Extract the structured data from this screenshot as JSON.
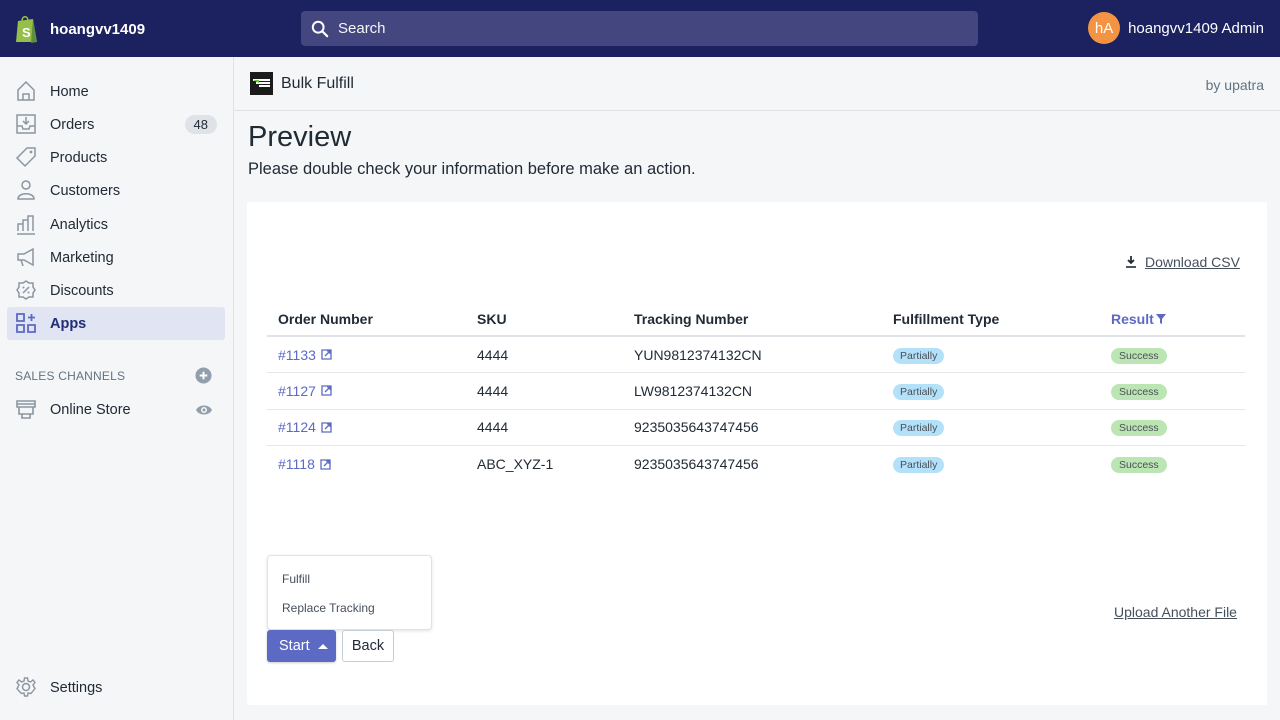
{
  "topbar": {
    "store_name": "hoangvv1409",
    "search_placeholder": "Search",
    "user_initials": "hA",
    "user_name": "hoangvv1409 Admin",
    "accent_color": "#1c2260"
  },
  "sidebar": {
    "items": [
      {
        "label": "Home",
        "icon": "home-icon"
      },
      {
        "label": "Orders",
        "icon": "orders-icon",
        "badge": "48"
      },
      {
        "label": "Products",
        "icon": "tag-icon"
      },
      {
        "label": "Customers",
        "icon": "person-icon"
      },
      {
        "label": "Analytics",
        "icon": "bar-chart-icon"
      },
      {
        "label": "Marketing",
        "icon": "megaphone-icon"
      },
      {
        "label": "Discounts",
        "icon": "discount-icon"
      },
      {
        "label": "Apps",
        "icon": "apps-icon",
        "active": true
      }
    ],
    "sales_channels_title": "SALES CHANNELS",
    "online_store_label": "Online Store",
    "settings_label": "Settings"
  },
  "app": {
    "title": "Bulk Fulfill",
    "by": "by upatra"
  },
  "page": {
    "title": "Preview",
    "subtitle": "Please double check your information before make an action.",
    "download_label": "Download CSV",
    "upload_label": "Upload Another File"
  },
  "table": {
    "headers": [
      "Order Number",
      "SKU",
      "Tracking Number",
      "Fulfillment Type",
      "Result"
    ],
    "rows": [
      {
        "order": "#1133",
        "sku": "4444",
        "tracking": "YUN9812374132CN",
        "type": "Partially",
        "result": "Success"
      },
      {
        "order": "#1127",
        "sku": "4444",
        "tracking": "LW9812374132CN",
        "type": "Partially",
        "result": "Success"
      },
      {
        "order": "#1124",
        "sku": "4444",
        "tracking": "9235035643747456",
        "type": "Partially",
        "result": "Success"
      },
      {
        "order": "#1118",
        "sku": "ABC_XYZ-1",
        "tracking": "9235035643747456",
        "type": "Partially",
        "result": "Success"
      }
    ]
  },
  "actions": {
    "dropdown_items": [
      "Fulfill",
      "Replace Tracking"
    ],
    "start_label": "Start",
    "back_label": "Back"
  }
}
